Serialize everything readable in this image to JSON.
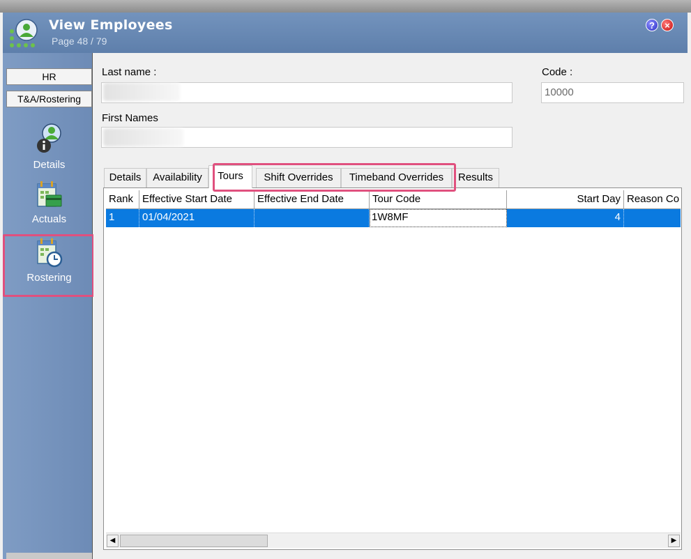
{
  "window": {
    "title": "View Employees",
    "page_info": "Page 48 / 79",
    "help_icon": "?",
    "close_icon": "×"
  },
  "sidebar": {
    "tabs": [
      {
        "label": "HR"
      },
      {
        "label": "T&A/Rostering"
      }
    ],
    "items": [
      {
        "label": "Details",
        "icon": "employee-info-icon"
      },
      {
        "label": "Actuals",
        "icon": "calendar-card-icon"
      },
      {
        "label": "Rostering",
        "icon": "calendar-clock-icon"
      }
    ]
  },
  "form": {
    "last_name_label": "Last name :",
    "last_name_value": "",
    "code_label": "Code :",
    "code_value": "10000",
    "first_names_label": "First Names",
    "first_names_value": ""
  },
  "tabs": [
    {
      "label": "Details"
    },
    {
      "label": "Availability"
    },
    {
      "label": "Tours"
    },
    {
      "label": "Shift Overrides"
    },
    {
      "label": "Timeband Overrides"
    },
    {
      "label": "Results"
    }
  ],
  "grid": {
    "columns": [
      "Rank",
      "Effective Start Date",
      "Effective End Date",
      "Tour Code",
      "Start Day",
      "Reason Co"
    ],
    "rows": [
      {
        "rank": "1",
        "start_date": "01/04/2021",
        "end_date": "",
        "tour_code": "1W8MF",
        "start_day": "4",
        "reason": ""
      }
    ]
  },
  "colors": {
    "titlebar": "#6685b1",
    "sidebar": "#7794bd",
    "selection": "#0a7ae0",
    "highlight": "#e0507e"
  }
}
